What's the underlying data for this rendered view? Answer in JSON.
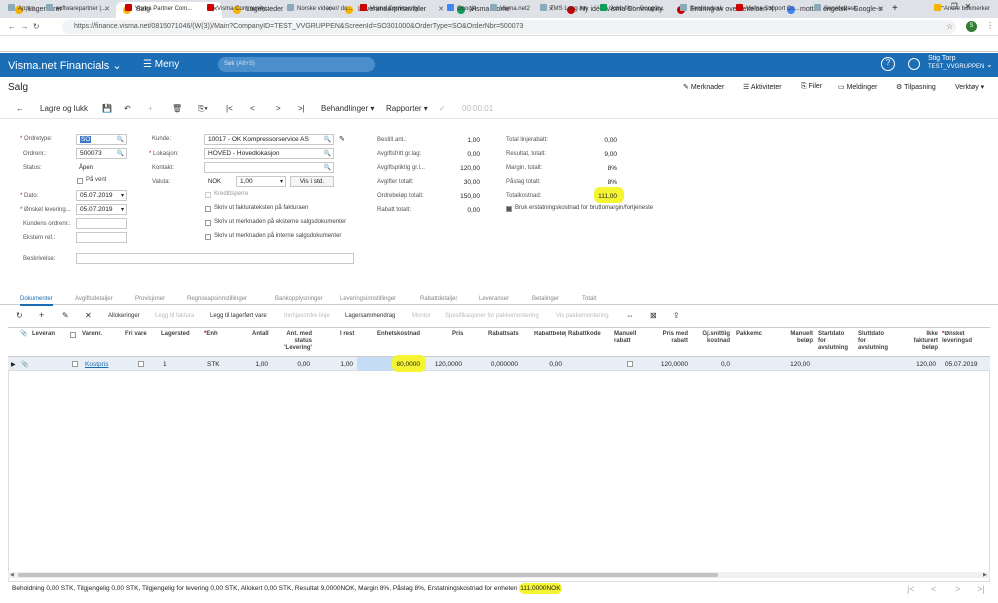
{
  "browser": {
    "tabs": [
      {
        "label": "Lagervarer",
        "color": "#f4b400"
      },
      {
        "label": "Salg",
        "color": "#f4b400"
      },
      {
        "label": "Lagersteder",
        "color": "#f4b400"
      },
      {
        "label": "Leverandørprisavtaler",
        "color": "#f4b400"
      },
      {
        "label": "Visma Home",
        "color": "#0f9d58"
      },
      {
        "label": "Ny idé - Visma Community",
        "color": "#c00"
      },
      {
        "label": "Endring av oversettelsen \"f",
        "color": "#c00"
      },
      {
        "label": "mottak engelsk - Google-s",
        "color": "#4285f4"
      }
    ],
    "url": "https://finance.visma.net/0815071046/(W(3))/Main?CompanyID=TEST_VVGRUPPEN&ScreenId=SO301000&OrderType=SO&OrderNbr=500073",
    "bookmarks": [
      "Apper",
      "softwarepartner |...",
      "Visma Partner Com...",
      "Visma Community...",
      "Norske videoer/ do...",
      "Visma Community:...",
      "Google",
      "Visma.net2",
      "TMS Logg inn",
      "Jobb filer - Google...",
      "Servicedesk",
      "Visma Support Co...",
      "Servicedesk",
      "Andre bokmerker"
    ]
  },
  "app": {
    "brand": "Visma.net Financials",
    "menu": "Meny",
    "search_placeholder": "Søk (Alt+S)",
    "user_name": "Stig Torp",
    "user_company": "TEST_VVGRUPPEN"
  },
  "page": {
    "title": "Salg",
    "links": [
      "Merknader",
      "Aktiviteter",
      "Filer",
      "Meldinger",
      "Tilpasning",
      "Verktøy"
    ]
  },
  "toolbar": {
    "save_close": "Lagre og lukk",
    "actions": "Behandlinger",
    "reports": "Rapporter",
    "timer": "00:00:01"
  },
  "form": {
    "ordretype_label": "Ordretype:",
    "ordretype": "SO",
    "ordrenr_label": "Ordrenr.:",
    "ordrenr": "500073",
    "status_label": "Status:",
    "status": "Åpen",
    "pa_vent": "På vent",
    "dato_label": "Dato:",
    "dato": "05.07.2019",
    "onsket_label": "Ønsket levering...",
    "onsket": "05.07.2019",
    "kundens_ordrenr_label": "Kundens ordrenr.:",
    "ekstern_ref_label": "Ekstern ref.:",
    "beskrivelse_label": "Beskrivelse:",
    "kunde_label": "Kunde:",
    "kunde": "10017 - OK Kompressorservice AS",
    "lokasjon_label": "Lokasjon:",
    "lokasjon": "HOVED - Hovedlokasjon",
    "kontakt_label": "Kontakt:",
    "valuta_label": "Valuta:",
    "valuta": "NOK",
    "kurs": "1,00",
    "vis_i_std": "Vis i std.",
    "checks": [
      "Kredittsperre",
      "Skriv ut fakturateksten på fakturaen",
      "Skriv ut merknaden på eksterne salgsdokumenter",
      "Skriv ut merknaden på interne salgsdokumenter"
    ],
    "totals_mid": [
      {
        "label": "Bestilt ant.:",
        "value": "1,00"
      },
      {
        "label": "Avgiftsfritt gr.lag:",
        "value": "0,00"
      },
      {
        "label": "Avgiftspliktig gr.l...",
        "value": "120,00"
      },
      {
        "label": "Avgifter totalt:",
        "value": "30,00"
      },
      {
        "label": "Ordrebeløp totalt:",
        "value": "150,00"
      },
      {
        "label": "Rabatt totalt:",
        "value": "0,00"
      }
    ],
    "totals_right": [
      {
        "label": "Total linjerabatt:",
        "value": "0,00"
      },
      {
        "label": "Resultat, totalt:",
        "value": "9,00"
      },
      {
        "label": "Margin, totalt:",
        "value": "8%"
      },
      {
        "label": "Påslag totalt:",
        "value": "8%"
      },
      {
        "label": "Totalkostnad:",
        "value": "111,00"
      }
    ],
    "bruk_erstatning": "Bruk erstatningskostnad for bruttomargin/fortjeneste"
  },
  "tabs": [
    "Dokumenter",
    "Avgiftsdetaljer",
    "Provisjoner",
    "Regnskapsinnstillinger",
    "Bankopplysninger",
    "Leveringsinnstillinger",
    "Rabattdetaljer",
    "Leveranser",
    "Betalinger",
    "Totalt"
  ],
  "grid_toolbar": {
    "allokeringer": "Allokeringer",
    "legg_til_faktura": "Legg til faktura",
    "legg_til_lagerfort": "Legg til lagerført vare",
    "innhjemle": "Innhjasordre linje",
    "lagersammendrag": "Lagersammendrag",
    "montor": "Montor",
    "spesifikasjoner": "Spesifikasjoner for pakkemontering",
    "vis_pakke": "Vis pakkemontering"
  },
  "grid": {
    "headers": [
      "Leveran",
      "Varenr.",
      "Fri vare",
      "Lagersted",
      "Enh",
      "Antall",
      "Ant. med status 'Levering'",
      "I rest",
      "Enhetskostnad",
      "Pris",
      "Rabattsats",
      "Rabattbeløp",
      "Rabattkode",
      "Manuell rabatt",
      "Pris med rabatt",
      "Gj.snittlig kostnad",
      "Pakkemc",
      "Manuelt beløp",
      "Startdato for avslutning",
      "Sluttdato for avslutning",
      "Ikke fakturert beløp",
      "Ønsket leveringsd"
    ],
    "row": {
      "varenr": "Kostpris",
      "lagersted": "1",
      "enh": "STK",
      "antall": "1,00",
      "ant_status": "0,00",
      "i_rest": "1,00",
      "enhetskostnad": "80,0000",
      "pris": "120,0000",
      "rabattsats": "0,000000",
      "rabattbelop": "0,00",
      "pris_rabatt": "120,0000",
      "gj_kostnad": "0,0",
      "manuelt": "120,00",
      "ikke_fakt": "120,00",
      "onsket": "05.07.2019"
    }
  },
  "status_bar": {
    "text": "Beholdning 0,00 STK, Tilgjengelig 0,00 STK, Tilgjengelig for levering 0,00 STK, Allokert 0,00 STK, Resultat 9,0000NOK, Margin 8%, Påslag 8%, Erstatningskostnad for enheten ",
    "highlight": "111,0000NOK"
  }
}
